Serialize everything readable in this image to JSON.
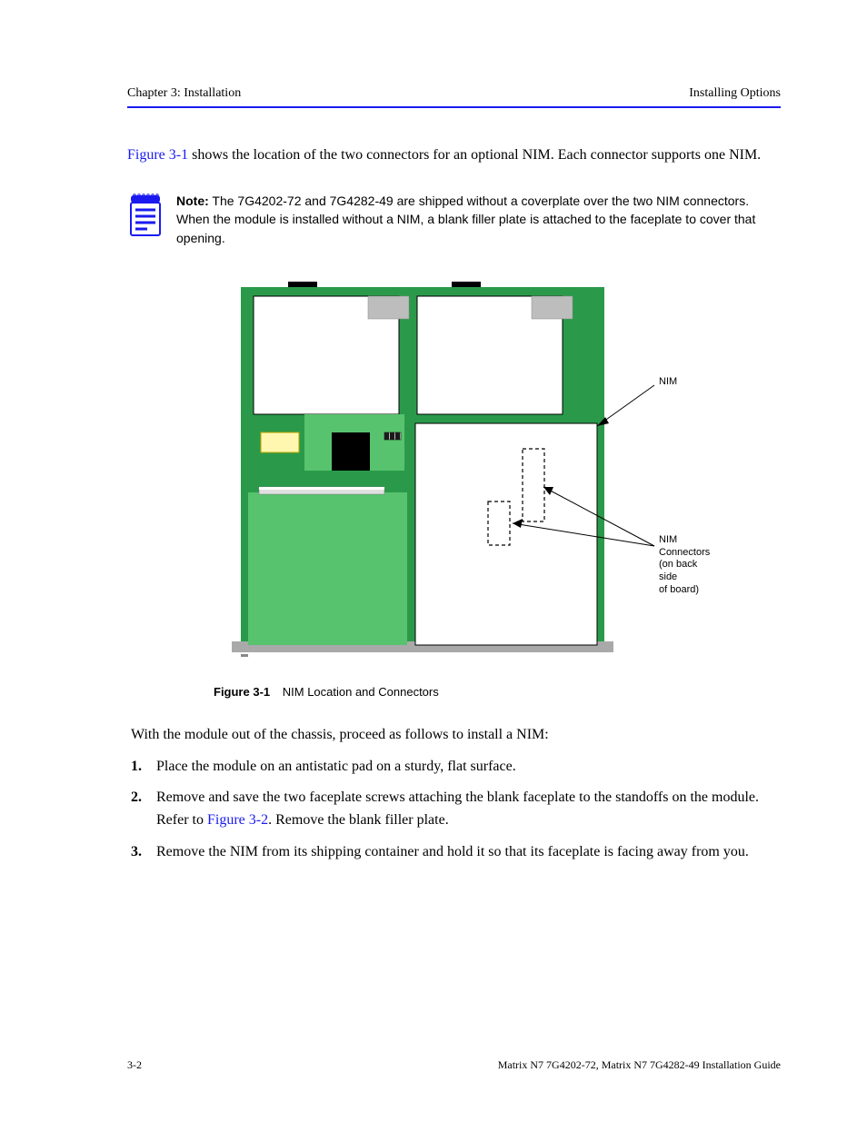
{
  "header": {
    "chapter": "Chapter 3: Installation",
    "section": "Installing Options"
  },
  "intro": {
    "p1a": "Figure 3-1",
    "p1b": " shows the location of the two connectors for an optional NIM. Each connector supports one NIM."
  },
  "note": {
    "label": "Note:",
    "body": "The 7G4202-72 and 7G4282-49 are shipped without a coverplate over the two NIM connectors. When the module is installed without a NIM, a blank filler plate is attached to the faceplate to cover that opening."
  },
  "figure": {
    "callout1": "NIM",
    "callout2_a": "NIM",
    "callout2_b": "Connectors",
    "callout2_c": "(on back side",
    "callout2_d": "of board)",
    "caption_num": "Figure 3-1",
    "caption_txt": "NIM Location and Connectors"
  },
  "steps": {
    "lead": "With the module out of the chassis, proceed as follows to install a NIM:",
    "s1": {
      "num": "1.",
      "txt": "Place the module on an antistatic pad on a sturdy, flat surface."
    },
    "s2a": {
      "num": "2.",
      "txt_a": "Remove and save the two faceplate screws attaching the blank faceplate to the standoffs on the module. Refer to ",
      "link": "Figure 3-2",
      "txt_b": ". Remove the blank filler plate."
    },
    "s3": {
      "num": "3.",
      "txt": "Remove the NIM from its shipping container and hold it so that its faceplate is facing away from you."
    }
  },
  "footer": {
    "left": "3-2",
    "right": "Matrix N7 7G4202-72, Matrix N7 7G4282-49 Installation Guide"
  }
}
